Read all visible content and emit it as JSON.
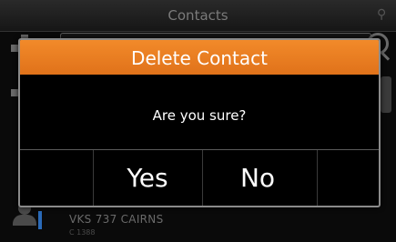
{
  "background": {
    "title": "Contacts",
    "list_item": {
      "name": "VKS 737 CAIRNS",
      "sub": "C 1388"
    }
  },
  "dialog": {
    "title": "Delete Contact",
    "message": "Are you sure?",
    "yes_label": "Yes",
    "no_label": "No"
  },
  "colors": {
    "accent": "#ef7f22",
    "dialog_bg": "#000000"
  },
  "icons": [
    "plus-icon",
    "minus-icon",
    "search-icon",
    "contact-icon"
  ]
}
